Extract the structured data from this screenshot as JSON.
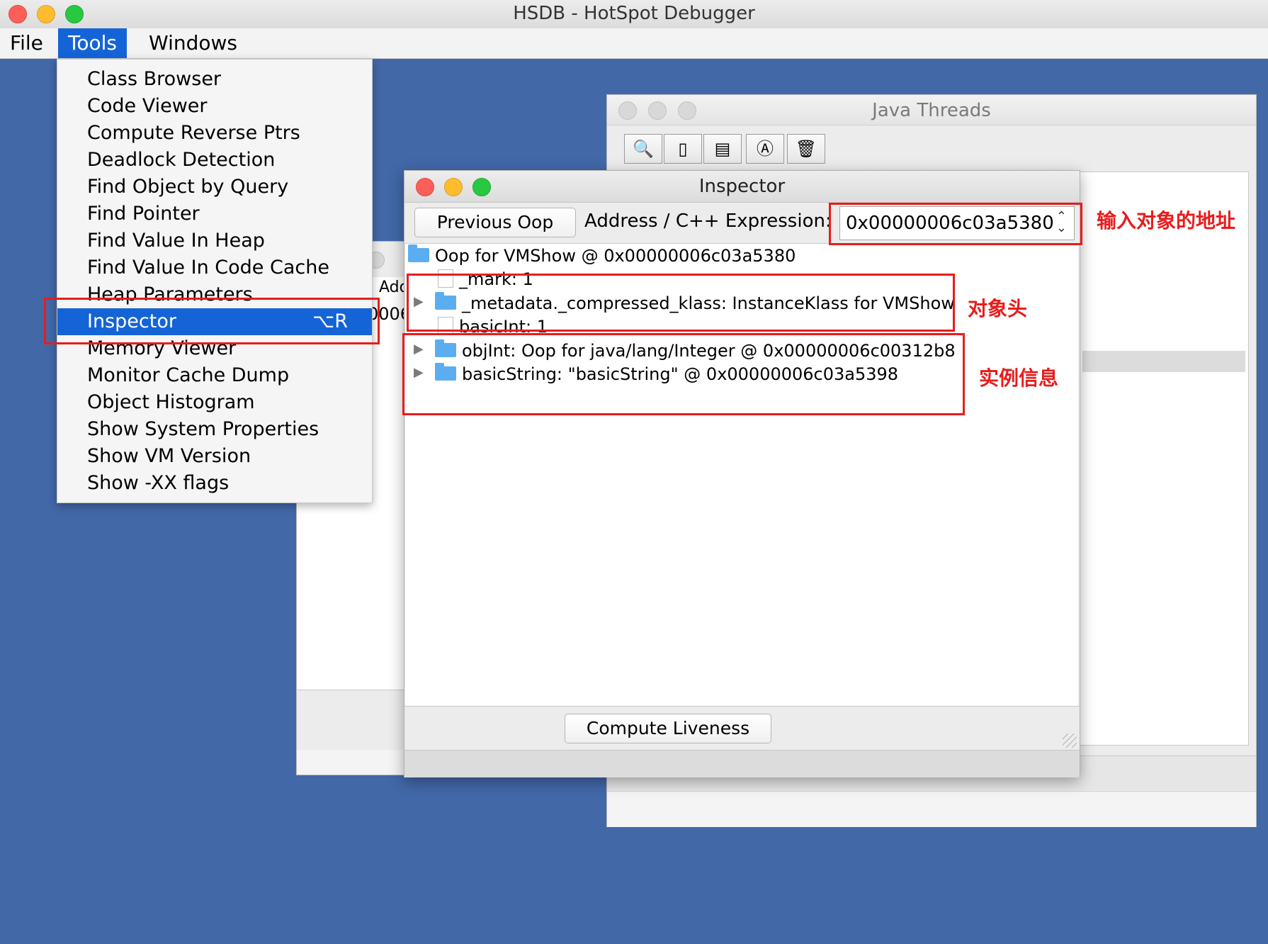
{
  "app": {
    "title": "HSDB - HotSpot Debugger"
  },
  "menubar": {
    "items": [
      "File",
      "Tools",
      "Windows"
    ]
  },
  "tools_menu": {
    "items": [
      "Class Browser",
      "Code Viewer",
      "Compute Reverse Ptrs",
      "Deadlock Detection",
      "Find Object by Query",
      "Find Pointer",
      "Find Value In Heap",
      "Find Value In Code Cache",
      "Heap Parameters",
      "Inspector",
      "Memory Viewer",
      "Monitor Cache Dump",
      "Object Histogram",
      "Show System Properties",
      "Show VM Version",
      "Show -XX flags"
    ],
    "selected": "Inspector",
    "selected_shortcut": "⌥R"
  },
  "java_threads": {
    "title": "Java Threads",
    "toolbar_icons": [
      "inspect-thread-icon",
      "stack-memory-icon",
      "thread-info-icon",
      "find-crashes-icon",
      "delete-icon"
    ]
  },
  "background_window": {
    "address_label": "Add",
    "value_fragment": "0006"
  },
  "inspector": {
    "title": "Inspector",
    "previous_button": "Previous Oop",
    "address_label": "Address / C++ Expression:",
    "address_value": "0x00000006c03a5380",
    "tree": {
      "root": "Oop for VMShow @ 0x00000006c03a5380",
      "mark": "_mark: 1",
      "metadata": "_metadata._compressed_klass: InstanceKlass for VMShow",
      "basic_int": "basicInt: 1",
      "obj_int": "objInt: Oop for java/lang/Integer @ 0x00000006c00312b8",
      "basic_string": "basicString: \"basicString\" @ 0x00000006c03a5398"
    },
    "compute_button": "Compute Liveness"
  },
  "annotations": {
    "address_note": "输入对象的地址",
    "header_note": "对象头",
    "instance_note": "实例信息"
  },
  "colors": {
    "desktop": "#4268a8",
    "highlight": "#1464d8",
    "annotation": "#e81c1c"
  }
}
